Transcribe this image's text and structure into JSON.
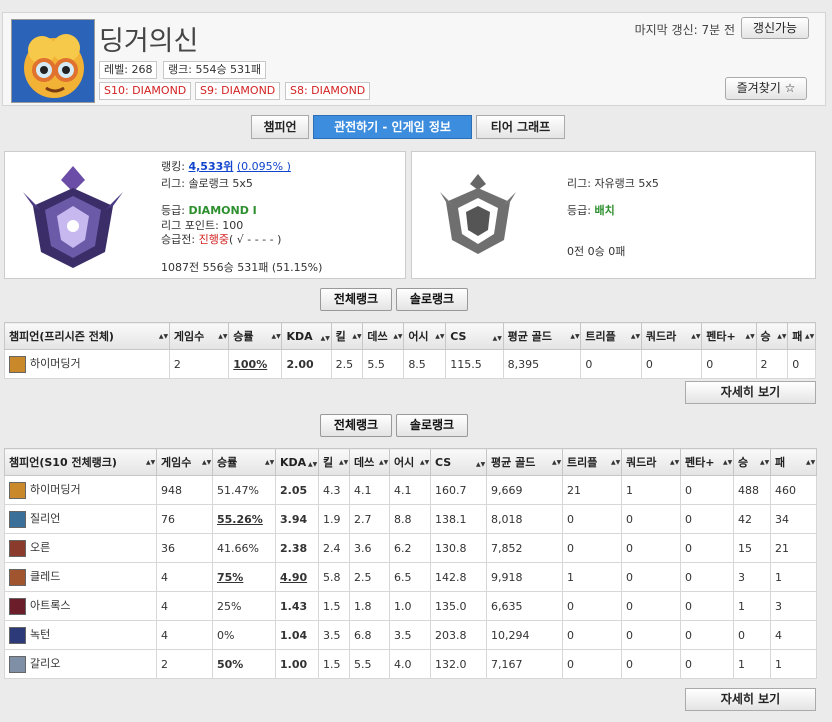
{
  "profile": {
    "summoner_name": "딩거의신",
    "level": "레벨: 268",
    "rank_record": "랭크: 554승 531패",
    "season_badges": [
      "S10: DIAMOND",
      "S9: DIAMOND",
      "S8: DIAMOND"
    ],
    "last_update": "마지막 갱신: 7분 전",
    "refresh_label": "갱신가능",
    "favorite_label": "즐겨찾기 ☆"
  },
  "tabs": [
    "챔피언",
    "관전하기 - 인게임 정보",
    "티어 그래프"
  ],
  "solo_rank": {
    "ranking_label": "랭킹:",
    "ranking_value": "4,533위",
    "ranking_pct": "(0.095% )",
    "league": "리그: 솔로랭크 5x5",
    "tier_label": "등급:",
    "tier_value": "DIAMOND I",
    "league_points": "리그 포인트: 100",
    "promo_label": "승급전:",
    "promo_status": "진행중",
    "promo_series": "( √ - - - - )",
    "record": "1087전 556승 531패 (51.15%)"
  },
  "flex_rank": {
    "league": "리그: 자유랭크 5x5",
    "tier_label": "등급:",
    "tier_value": "배치",
    "record": "0전 0승 0패"
  },
  "rank_toggle": {
    "all": "전체랭크",
    "solo": "솔로랭크"
  },
  "preseason_table": {
    "headers": [
      "챔피언(프리시즌 전체)",
      "게임수",
      "승률",
      "KDA",
      "킬",
      "데쓰",
      "어시",
      "CS",
      "평균 골드",
      "트리플",
      "쿼드라",
      "펜타+",
      "승",
      "패"
    ],
    "rows": [
      {
        "champion": "하이머딩거",
        "games": "2",
        "winrate": "100%",
        "kda": "2.00",
        "kills": "2.5",
        "deaths": "5.5",
        "assists": "8.5",
        "cs": "115.5",
        "gold": "8,395",
        "triple": "0",
        "quadra": "0",
        "penta": "0",
        "wins": "2",
        "losses": "0",
        "color": "#c9892b",
        "wr_style": "wr-red",
        "kda_style": "kda-green"
      }
    ],
    "detail_label": "자세히 보기"
  },
  "season_table": {
    "headers": [
      "챔피언(S10 전체랭크)",
      "게임수",
      "승률",
      "KDA",
      "킬",
      "데쓰",
      "어시",
      "CS",
      "평균 골드",
      "트리플",
      "쿼드라",
      "펜타+",
      "승",
      "패"
    ],
    "rows": [
      {
        "champion": "하이머딩거",
        "games": "948",
        "winrate": "51.47%",
        "kda": "2.05",
        "kills": "4.3",
        "deaths": "4.1",
        "assists": "4.1",
        "cs": "160.7",
        "gold": "9,669",
        "triple": "21",
        "quadra": "1",
        "penta": "0",
        "wins": "488",
        "losses": "460",
        "color": "#c9892b",
        "wr_style": "wr-green",
        "kda_style": "kda-green"
      },
      {
        "champion": "질리언",
        "games": "76",
        "winrate": "55.26%",
        "kda": "3.94",
        "kills": "1.9",
        "deaths": "2.7",
        "assists": "8.8",
        "cs": "138.1",
        "gold": "8,018",
        "triple": "0",
        "quadra": "0",
        "penta": "0",
        "wins": "42",
        "losses": "34",
        "color": "#3a6f9a",
        "wr_style": "wr-red",
        "kda_style": "kda-blue"
      },
      {
        "champion": "오른",
        "games": "36",
        "winrate": "41.66%",
        "kda": "2.38",
        "kills": "2.4",
        "deaths": "3.6",
        "assists": "6.2",
        "cs": "130.8",
        "gold": "7,852",
        "triple": "0",
        "quadra": "0",
        "penta": "0",
        "wins": "15",
        "losses": "21",
        "color": "#8a3b2b",
        "wr_style": "",
        "kda_style": "kda-green"
      },
      {
        "champion": "클레드",
        "games": "4",
        "winrate": "75%",
        "kda": "4.90",
        "kills": "5.8",
        "deaths": "2.5",
        "assists": "6.5",
        "cs": "142.8",
        "gold": "9,918",
        "triple": "1",
        "quadra": "0",
        "penta": "0",
        "wins": "3",
        "losses": "1",
        "color": "#a0552e",
        "wr_style": "wr-red",
        "kda_style": "kda-red"
      },
      {
        "champion": "아트록스",
        "games": "4",
        "winrate": "25%",
        "kda": "1.43",
        "kills": "1.5",
        "deaths": "1.8",
        "assists": "1.0",
        "cs": "135.0",
        "gold": "6,635",
        "triple": "0",
        "quadra": "0",
        "penta": "0",
        "wins": "1",
        "losses": "3",
        "color": "#6b1e2a",
        "wr_style": "",
        "kda_style": "kda-gray"
      },
      {
        "champion": "녹턴",
        "games": "4",
        "winrate": "0%",
        "kda": "1.04",
        "kills": "3.5",
        "deaths": "6.8",
        "assists": "3.5",
        "cs": "203.8",
        "gold": "10,294",
        "triple": "0",
        "quadra": "0",
        "penta": "0",
        "wins": "0",
        "losses": "4",
        "color": "#2c3a7a",
        "wr_style": "",
        "kda_style": "kda-gray"
      },
      {
        "champion": "갈리오",
        "games": "2",
        "winrate": "50%",
        "kda": "1.00",
        "kills": "1.5",
        "deaths": "5.5",
        "assists": "4.0",
        "cs": "132.0",
        "gold": "7,167",
        "triple": "0",
        "quadra": "0",
        "penta": "0",
        "wins": "1",
        "losses": "1",
        "color": "#7f8fa6",
        "wr_style": "bold",
        "kda_style": "kda-gray"
      }
    ],
    "detail_label": "자세히 보기"
  }
}
